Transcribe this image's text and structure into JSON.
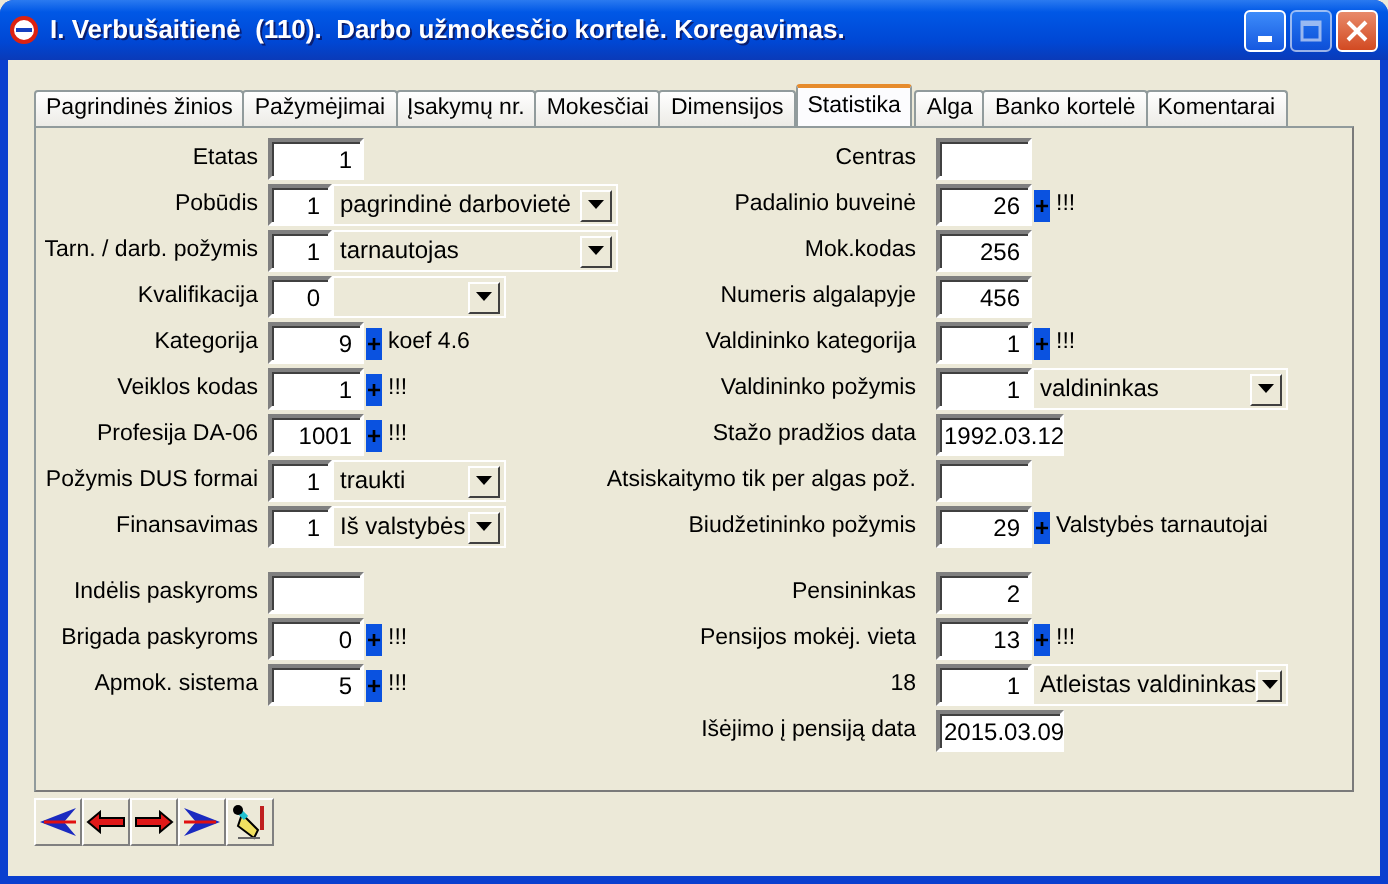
{
  "window": {
    "title": "I. Verbušaitienė  (110).  Darbo užmokesčio kortelė. Koregavimas."
  },
  "tabs": [
    {
      "label": "Pagrindinės žinios",
      "selected": false
    },
    {
      "label": "Pažymėjimai",
      "selected": false
    },
    {
      "label": "Įsakymų nr.",
      "selected": false
    },
    {
      "label": "Mokesčiai",
      "selected": false
    },
    {
      "label": "Dimensijos",
      "selected": false
    },
    {
      "label": "Statistika",
      "selected": true
    },
    {
      "label": "Alga",
      "selected": false
    },
    {
      "label": "Banko kortelė",
      "selected": false
    },
    {
      "label": "Komentarai",
      "selected": false
    }
  ],
  "columns": [
    {
      "groups": [
        {
          "fields": [
            {
              "label": "Etatas",
              "kind": "text",
              "value": "1"
            },
            {
              "label": "Pobūdis",
              "kind": "combo",
              "code": "1",
              "option": "pagrindinė darbovietė"
            },
            {
              "label": "Tarn. / darb. požymis",
              "kind": "combo",
              "code": "1",
              "option": "tarnautojas"
            },
            {
              "label": "Kvalifikacija",
              "kind": "shortcombo",
              "code": "0"
            },
            {
              "label": "Kategorija",
              "kind": "plus",
              "value": "9",
              "button": "+",
              "note": "koef 4.6"
            },
            {
              "label": "Veiklos kodas",
              "kind": "plus",
              "value": "1",
              "button": "+",
              "note": "!!!"
            },
            {
              "label": "Profesija DA-06",
              "kind": "plus",
              "value": "1001",
              "button": "+",
              "note": "!!!"
            },
            {
              "label": "Požymis DUS formai",
              "kind": "shortcombo",
              "code": "1",
              "option": "traukti"
            },
            {
              "label": "Finansavimas",
              "kind": "shortcombo",
              "code": "1",
              "option": "Iš valstybės"
            }
          ]
        },
        {
          "fields": [
            {
              "label": "Indėlis paskyroms",
              "kind": "text"
            },
            {
              "label": "Brigada paskyroms",
              "kind": "plus",
              "value": "0",
              "button": "+",
              "note": "!!!"
            },
            {
              "label": "Apmok. sistema",
              "kind": "plus",
              "value": "5",
              "button": "+",
              "note": "!!!"
            }
          ]
        }
      ]
    },
    {
      "groups": [
        {
          "fields": [
            {
              "label": "Centras",
              "kind": "text"
            },
            {
              "label": "Padalinio buveinė",
              "kind": "plus",
              "value": "26",
              "button": "+",
              "note": "!!!"
            },
            {
              "label": "Mok.kodas",
              "kind": "text",
              "value": "256"
            },
            {
              "label": "Numeris algalapyje",
              "kind": "text",
              "value": "456"
            },
            {
              "label": "Valdininko kategorija",
              "kind": "plus",
              "value": "1",
              "button": "+",
              "note": "!!!"
            },
            {
              "label": "Valdininko požymis",
              "kind": "combo",
              "code": "1",
              "option": "valdininkas"
            },
            {
              "label": "Stažo pradžios data",
              "kind": "date",
              "value": "1992.03.12"
            },
            {
              "label": "Atsiskaitymo tik per algas pož.",
              "kind": "text"
            },
            {
              "label": "Biudžetininko požymis",
              "kind": "plus",
              "value": "29",
              "button": "+",
              "note": "Valstybės tarnautojai"
            }
          ]
        },
        {
          "fields": [
            {
              "label": "Pensininkas",
              "kind": "text",
              "value": "2"
            },
            {
              "label": "Pensijos mokėj. vieta",
              "kind": "plus",
              "value": "13",
              "button": "+",
              "note": "!!!"
            },
            {
              "label": "18",
              "kind": "combo",
              "code": "1",
              "option": "Atleistas valdininkas"
            },
            {
              "label": "Išėjimo į pensiją data",
              "kind": "date",
              "value": "2015.03.09"
            }
          ]
        }
      ]
    }
  ],
  "toolbar": [
    {
      "kind": "first"
    },
    {
      "kind": "previous"
    },
    {
      "kind": "next"
    },
    {
      "kind": "last"
    },
    {
      "kind": "edit"
    }
  ]
}
